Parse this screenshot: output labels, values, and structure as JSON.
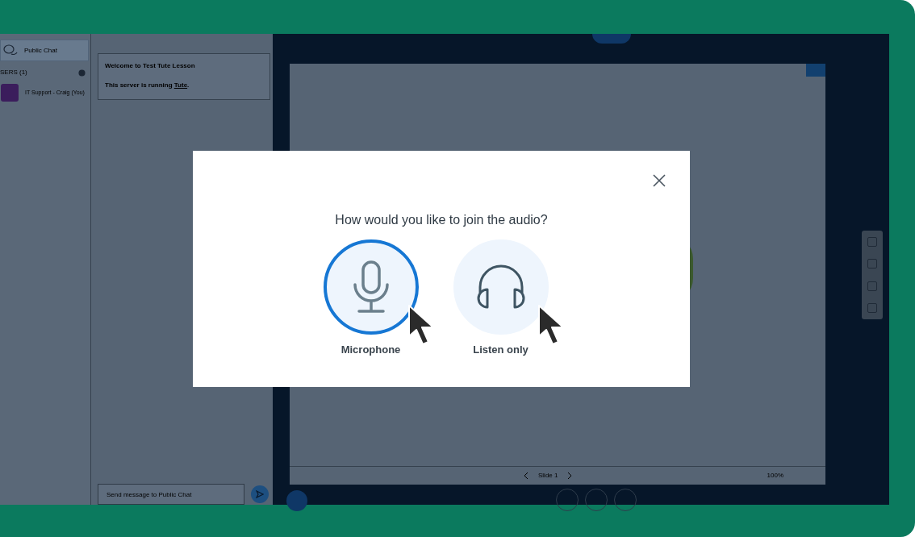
{
  "sidebar": {
    "public_chat": "Public Chat",
    "users_heading": "SERS (1)",
    "users": [
      {
        "name": "IT Support - Craig (You)"
      }
    ]
  },
  "chat": {
    "welcome": "Welcome to Test Tute Lesson",
    "server_text": "This server is running ",
    "server_link": "Tute",
    "server_end": ".",
    "input_placeholder": "Send message to Public Chat"
  },
  "presentation": {
    "slide_label": "Slide 1",
    "zoom": "100%"
  },
  "dialog": {
    "title": "How would you like to join the audio?",
    "options": [
      {
        "kind": "microphone",
        "label": "Microphone",
        "selected": true
      },
      {
        "kind": "listen",
        "label": "Listen only",
        "selected": false
      }
    ]
  }
}
